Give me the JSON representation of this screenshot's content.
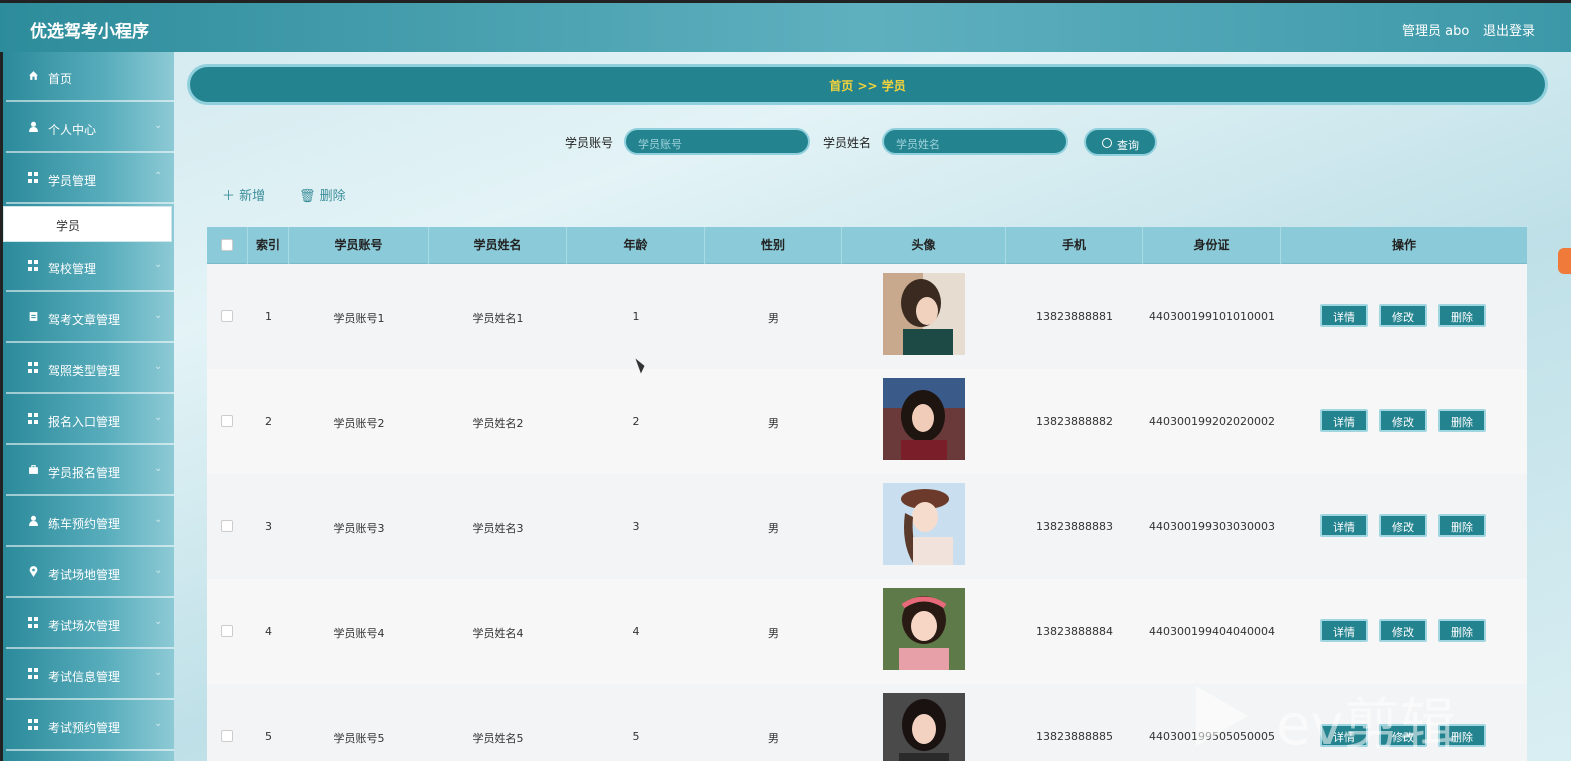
{
  "app": {
    "title": "优选驾考小程序",
    "admin_label": "管理员 abo",
    "logout_label": "退出登录"
  },
  "sidebar": {
    "items": [
      {
        "label": "首页",
        "icon": "home-icon"
      },
      {
        "label": "个人中心",
        "icon": "user-icon"
      },
      {
        "label": "学员管理",
        "icon": "grid-icon"
      },
      {
        "label": "驾校管理",
        "icon": "grid-icon"
      },
      {
        "label": "驾考文章管理",
        "icon": "document-icon"
      },
      {
        "label": "驾照类型管理",
        "icon": "grid-icon"
      },
      {
        "label": "报名入口管理",
        "icon": "grid-icon"
      },
      {
        "label": "学员报名管理",
        "icon": "briefcase-icon"
      },
      {
        "label": "练车预约管理",
        "icon": "user-icon"
      },
      {
        "label": "考试场地管理",
        "icon": "location-icon"
      },
      {
        "label": "考试场次管理",
        "icon": "grid-icon"
      },
      {
        "label": "考试信息管理",
        "icon": "grid-icon"
      },
      {
        "label": "考试预约管理",
        "icon": "grid-icon"
      }
    ],
    "active_sub": "学员"
  },
  "breadcrumb": {
    "text": "首页  >>  学员"
  },
  "search": {
    "account_label": "学员账号",
    "account_placeholder": "学员账号",
    "name_label": "学员姓名",
    "name_placeholder": "学员姓名",
    "button_label": "查询"
  },
  "actions": {
    "add_label": "新增",
    "delete_label": "删除"
  },
  "table": {
    "headers": [
      "索引",
      "学员账号",
      "学员姓名",
      "年龄",
      "性别",
      "头像",
      "手机",
      "身份证",
      "操作"
    ],
    "rows": [
      {
        "index": "1",
        "account": "学员账号1",
        "name": "学员姓名1",
        "age": "1",
        "gender": "男",
        "phone": "13823888881",
        "id_card": "440300199101010001"
      },
      {
        "index": "2",
        "account": "学员账号2",
        "name": "学员姓名2",
        "age": "2",
        "gender": "男",
        "phone": "13823888882",
        "id_card": "440300199202020002"
      },
      {
        "index": "3",
        "account": "学员账号3",
        "name": "学员姓名3",
        "age": "3",
        "gender": "男",
        "phone": "13823888883",
        "id_card": "440300199303030003"
      },
      {
        "index": "4",
        "account": "学员账号4",
        "name": "学员姓名4",
        "age": "4",
        "gender": "男",
        "phone": "13823888884",
        "id_card": "440300199404040004"
      },
      {
        "index": "5",
        "account": "学员账号5",
        "name": "学员姓名5",
        "age": "5",
        "gender": "男",
        "phone": "13823888885",
        "id_card": "440300199505050005"
      }
    ],
    "op_labels": {
      "detail": "详情",
      "edit": "修改",
      "delete": "删除"
    }
  },
  "watermark": {
    "text": "ev剪辑"
  },
  "colors": {
    "primary": "#23838f",
    "accent": "#8bcad8",
    "breadcrumb_text": "#f2d33b"
  }
}
